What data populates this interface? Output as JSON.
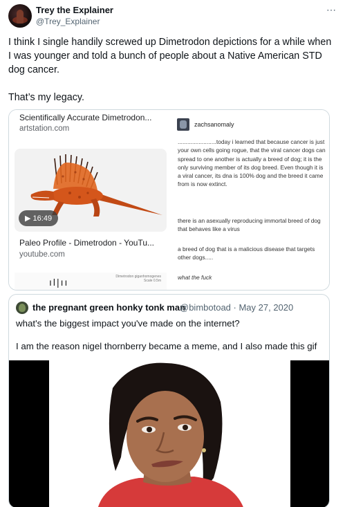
{
  "tweet": {
    "author_name": "Trey the Explainer",
    "author_handle": "@Trey_Explainer",
    "more_icon": "⋯",
    "paragraphs": [
      "I think I single handily screwed up Dimetrodon depictions for a while when I was younger and told a bunch of people about a Native American STD dog cancer.",
      "That’s my legacy."
    ]
  },
  "card": {
    "link1": {
      "title": "Scientifically Accurate Dimetrodon...",
      "domain": "artstation.com"
    },
    "video_duration": "16:49",
    "link2": {
      "title": "Paleo Profile - Dimetrodon - YouTu...",
      "domain": "youtube.com"
    },
    "thumb_caption": [
      "Dimetrodon giganhomogenes",
      "Scale 0.5m"
    ],
    "tumblr": {
      "username": "zachsanomaly",
      "post": "........................today i learned that because cancer is just your own cells going rogue, that the viral cancer dogs can spread to one another is actually a breed of dog; it is the only surviving member of its dog breed. Even though it is a viral cancer, its dna is 100% dog and the breed it came from is now extinct.",
      "reply1": "there is an asexually reproducing immortal breed of dog that behaves like a virus",
      "reply2": "a breed of dog that is a malicious disease that targets other dogs.....",
      "reply3": "what the fuck"
    }
  },
  "quote": {
    "author_name": "the pregnant green honky tonk man",
    "meta": "@bimbotoad · May 27, 2020",
    "line1": "what's the biggest impact you've made on the internet?",
    "line2": "I am the reason nigel thornberry became a meme, and I also made this gif"
  },
  "colors": {
    "text": "#0f1419",
    "secondary": "#536471",
    "border": "#cfd9de",
    "dino_orange": "#d4561b",
    "shirt_red": "#d63a3a"
  }
}
